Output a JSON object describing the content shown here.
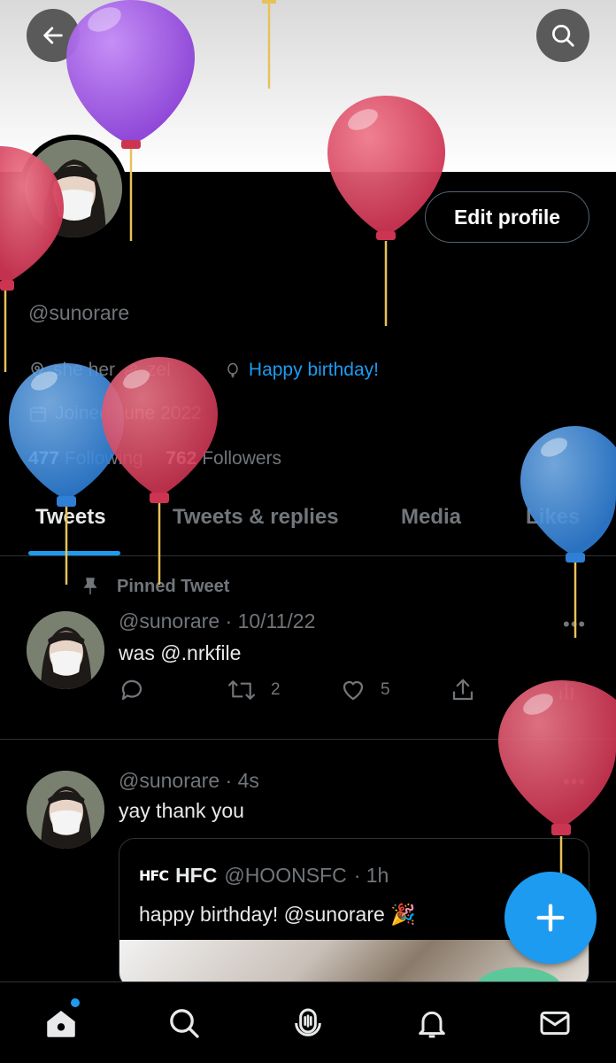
{
  "profile": {
    "handle": "@sunorare",
    "edit_label": "Edit profile",
    "pronouns": "she her",
    "location_short": "zel",
    "birthday_text": "Happy birthday!",
    "joined": "Joined June 2022",
    "following_count": "477",
    "following_label": "Following",
    "followers_count": "762",
    "followers_label": "Followers"
  },
  "tabs": [
    {
      "label": "Tweets",
      "active": true
    },
    {
      "label": "Tweets & replies",
      "active": false
    },
    {
      "label": "Media",
      "active": false
    },
    {
      "label": "Likes",
      "active": false
    }
  ],
  "pinned_label": "Pinned Tweet",
  "tweets": [
    {
      "handle": "@sunorare",
      "time": "· 10/11/22",
      "text": "was @.nrkfile",
      "retweets": "2",
      "likes": "5"
    },
    {
      "handle": "@sunorare",
      "time": "· 4s",
      "text": "yay thank you",
      "quote": {
        "logo": "HFC",
        "name": "HFC",
        "handle": "@HOONSFC",
        "time": "· 1h",
        "text": "happy birthday! @sunorare 🎉"
      }
    }
  ],
  "colors": {
    "accent": "#1d9bf0",
    "balloon_purple": "#9b4fe0",
    "balloon_red": "#d9445e",
    "balloon_blue": "#3b8fe3",
    "muted": "#71767b"
  },
  "icons": {
    "back": "arrow-left-icon",
    "search": "search-icon",
    "home": "home-icon",
    "spaces": "spaces-icon",
    "notifications": "bell-icon",
    "messages": "mail-icon"
  }
}
